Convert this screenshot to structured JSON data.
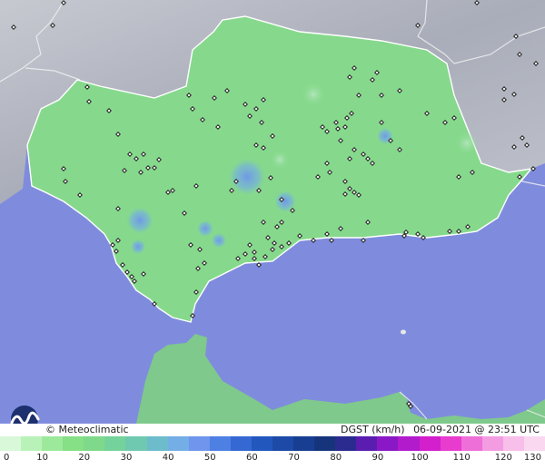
{
  "credit": "© Meteoclimatic",
  "caption": {
    "variable": "DGST (km/h)",
    "datetime": "06-09-2021 @ 23:51 UTC"
  },
  "legend": {
    "ticks": [
      "0",
      "10",
      "20",
      "30",
      "40",
      "50",
      "60",
      "70",
      "80",
      "90",
      "100",
      "110",
      "120",
      "130"
    ],
    "colors": [
      "#d9f7d9",
      "#b9f2b9",
      "#9ce99c",
      "#86e086",
      "#7fd98a",
      "#74d39a",
      "#6ec9b0",
      "#6cbccc",
      "#74aee6",
      "#6f95ec",
      "#4e7fe3",
      "#3568d2",
      "#2257bd",
      "#1c4aa6",
      "#173e91",
      "#16347c",
      "#2b2a8f",
      "#5b1cb0",
      "#8a18c6",
      "#b21bcc",
      "#d31fcc",
      "#e83ccf",
      "#ef6fd9",
      "#f39ce2",
      "#f7bfea",
      "#f9d8f0"
    ]
  },
  "colors": {
    "sea": "#7f8cdd",
    "land_outside": "#b9bcc6",
    "region": "#86d98c",
    "gust_high": "#7fa9e6",
    "station": "#222222"
  },
  "icons": {
    "logo": "meteoclimatic-wave-logo",
    "station": "station-marker-icon"
  }
}
